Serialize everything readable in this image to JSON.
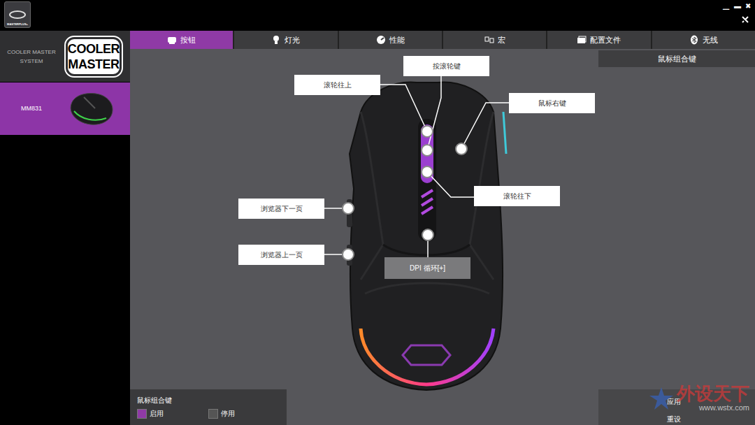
{
  "app": {
    "logo_text": "MASTERPLUS+",
    "window_controls": [
      "▁",
      "▬",
      "✖"
    ]
  },
  "sidebar": {
    "system_label": "COOLER MASTER SYSTEM",
    "brand": [
      "COOLER",
      "MASTER"
    ],
    "devices": [
      {
        "name": "MM831",
        "selected": true
      }
    ]
  },
  "tabs": [
    {
      "label": "按钮",
      "selected": true
    },
    {
      "label": "灯光",
      "selected": false
    },
    {
      "label": "性能",
      "selected": false
    },
    {
      "label": "宏",
      "selected": false
    },
    {
      "label": "配置文件",
      "selected": false
    },
    {
      "label": "无线",
      "selected": false
    }
  ],
  "callouts": [
    {
      "label": "滚轮往上",
      "selected": false
    },
    {
      "label": "按滚轮键",
      "selected": false
    },
    {
      "label": "鼠标右键",
      "selected": false
    },
    {
      "label": "滚轮往下",
      "selected": false
    },
    {
      "label": "浏览器下一页",
      "selected": false
    },
    {
      "label": "浏览器上一页",
      "selected": false
    },
    {
      "label": "DPI 循环[+]",
      "selected": true
    }
  ],
  "side_panel": {
    "title": "鼠标组合键"
  },
  "combo_panel": {
    "title": "鼠标组合键",
    "options": [
      {
        "label": "启用",
        "selected": true
      },
      {
        "label": "停用",
        "selected": false
      }
    ]
  },
  "buttons": [
    "应用",
    "重设"
  ],
  "watermark": {
    "text": "外设天下",
    "url": "www.wstx.com"
  }
}
